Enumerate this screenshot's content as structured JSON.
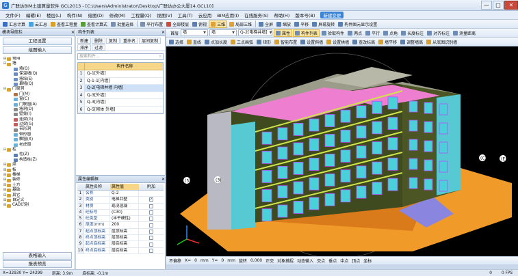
{
  "window": {
    "title": "广联达BIM土建算量软件 GCL2013 - [C:\\Users\\Administrator\\Desktop\\广联达办公大厦14.GCL10]",
    "app_icon": "G",
    "controls": [
      "—",
      "□",
      "✕"
    ]
  },
  "menu": [
    "文件(F)",
    "编辑(E)",
    "楼层(L)",
    "构件(N)",
    "绘图(D)",
    "修改(M)",
    "工程量(Q)",
    "视图(V)",
    "工具(T)",
    "云应用",
    "BIM应用(I)",
    "在线服务(S)",
    "帮助(H)",
    "版本号(B)",
    "新建变更"
  ],
  "toolbar1": [
    {
      "label": "汇总计算",
      "icon": "sigma-icon",
      "color": "#3a6fc4"
    },
    {
      "label": "云汇总",
      "icon": "cloud-icon",
      "color": "#4aa3e0"
    },
    {
      "label": "查看工程量",
      "icon": "table-icon",
      "color": "#d9a12a"
    },
    {
      "label": "查看计算式",
      "icon": "formula-icon",
      "color": "#5b9c3a"
    },
    {
      "label": "批量选择",
      "icon": "select-icon",
      "color": "#7b8fae"
    },
    {
      "label": "平行布置",
      "icon": "parallel-icon",
      "color": "#7b8fae"
    },
    {
      "label": "全部楼层",
      "icon": "layers-icon",
      "color": "#c94f3a"
    },
    {
      "label": "俯视",
      "icon": "view-icon",
      "color": "#5a7fb0"
    },
    {
      "label": "三维",
      "icon": "cube-icon",
      "color": "#e0a03a"
    },
    {
      "label": "局部三维",
      "icon": "cube-icon",
      "color": "#e0a03a"
    },
    {
      "label": "全屏",
      "icon": "fullscreen-icon",
      "color": "#5a7fb0"
    },
    {
      "label": "缩放",
      "icon": "zoom-icon",
      "color": "#5a7fb0"
    },
    {
      "label": "平移",
      "icon": "pan-icon",
      "color": "#5a7fb0"
    },
    {
      "label": "屏幕旋转",
      "icon": "rotate-icon",
      "color": "#5a7fb0"
    },
    {
      "label": "构件图元显示设置",
      "icon": "settings-icon",
      "color": "#5a7fb0"
    }
  ],
  "toolbar2": {
    "floor_label": "首层",
    "type_combo": "墙",
    "sub_combo": "墙",
    "element_combo": "Q-2[电梯井墙]",
    "buttons": [
      "属性",
      "构件列表",
      "拾取构件",
      "两点",
      "平行",
      "点角",
      "长度标注",
      "对齐标注",
      "测量距离"
    ]
  },
  "toolbar3": [
    "选择",
    "直线",
    "点加长度",
    "三点画弧",
    "矩形",
    "智能布置",
    "设置斜墙",
    "设置拱墙",
    "查改标高",
    "墙平移",
    "调整墙高",
    "从底图识别墙"
  ],
  "nav": {
    "title": "模块导航栏",
    "buttons": [
      "工程设置",
      "绘图输入"
    ],
    "tree": [
      {
        "label": "常用",
        "level": 0,
        "expanded": false,
        "color": "#d9a12a"
      },
      {
        "label": "墙",
        "level": 0,
        "expanded": true,
        "color": "#d9a12a"
      },
      {
        "label": "墙(Q)",
        "level": 1,
        "color": "#6a8fc6"
      },
      {
        "label": "保温墙(Q)",
        "level": 1,
        "color": "#6a8fc6"
      },
      {
        "label": "墙垛(E)",
        "level": 1,
        "color": "#6a8fc6"
      },
      {
        "label": "幕墙(Q)",
        "level": 1,
        "color": "#6a8fc6"
      },
      {
        "label": "门窗洞",
        "level": 0,
        "expanded": true,
        "color": "#d9a12a"
      },
      {
        "label": "门(M)",
        "level": 1,
        "color": "#b0764a"
      },
      {
        "label": "窗(C)",
        "level": 1,
        "color": "#6ab0d8"
      },
      {
        "label": "门联窗(A)",
        "level": 1,
        "color": "#6ab0d8"
      },
      {
        "label": "墙洞(D)",
        "level": 1,
        "color": "#888"
      },
      {
        "label": "壁龛(I)",
        "level": 1,
        "color": "#888"
      },
      {
        "label": "连梁(G)",
        "level": 1,
        "color": "#c45a5a"
      },
      {
        "label": "过梁(G)",
        "level": 1,
        "color": "#c45a5a"
      },
      {
        "label": "带形洞",
        "level": 1,
        "color": "#888"
      },
      {
        "label": "带形窗",
        "level": 1,
        "color": "#6ab0d8"
      },
      {
        "label": "飘窗(X)",
        "level": 1,
        "color": "#6ab0d8"
      },
      {
        "label": "老虎窗",
        "level": 1,
        "color": "#6ab0d8"
      },
      {
        "label": "柱",
        "level": 0,
        "expanded": true,
        "color": "#d9a12a"
      },
      {
        "label": "柱(Z)",
        "level": 1,
        "color": "#5a7fb0"
      },
      {
        "label": "构造柱(Z)",
        "level": 1,
        "color": "#5a7fb0"
      },
      {
        "label": "梁",
        "level": 0,
        "expanded": false,
        "color": "#d9a12a"
      },
      {
        "label": "板",
        "level": 0,
        "expanded": false,
        "color": "#d9a12a"
      },
      {
        "label": "楼梯",
        "level": 0,
        "expanded": false,
        "color": "#d9a12a"
      },
      {
        "label": "装修",
        "level": 0,
        "expanded": false,
        "color": "#d9a12a"
      },
      {
        "label": "土方",
        "level": 0,
        "expanded": false,
        "color": "#d9a12a"
      },
      {
        "label": "基础",
        "level": 0,
        "expanded": false,
        "color": "#d9a12a"
      },
      {
        "label": "其它",
        "level": 0,
        "expanded": false,
        "color": "#d9a12a"
      },
      {
        "label": "自定义",
        "level": 0,
        "expanded": false,
        "color": "#d9a12a"
      },
      {
        "label": "CAD识别",
        "level": 0,
        "expanded": false,
        "color": "#d9a12a"
      }
    ],
    "footer_buttons": [
      "表格输入",
      "报表预览"
    ]
  },
  "component_list": {
    "title": "构件列表",
    "toolbar": [
      "新建",
      "删除",
      "复制",
      "重命名",
      "层间复制",
      "排序",
      "过滤"
    ],
    "search_placeholder": "搜索构件...",
    "header": "构件名称",
    "rows": [
      {
        "n": "1",
        "name": "Q-1[外墙]"
      },
      {
        "n": "2",
        "name": "Q-1-1[内墙]"
      },
      {
        "n": "3",
        "name": "Q-2[电梯井墙 内墙]"
      },
      {
        "n": "4",
        "name": "Q-3[外墙]"
      },
      {
        "n": "5",
        "name": "Q-3[内墙]"
      },
      {
        "n": "6",
        "name": "Q-5[砌体 外墙]"
      }
    ],
    "selected_index": 2
  },
  "property_editor": {
    "title": "属性编辑框",
    "headers": {
      "name": "属性名称",
      "value": "属性值",
      "extra": "附加"
    },
    "rows": [
      {
        "n": "1",
        "k": "名称",
        "v": "Q-2",
        "checked": null
      },
      {
        "n": "2",
        "k": "类别",
        "v": "电梯井壁",
        "checked": true
      },
      {
        "n": "3",
        "k": "材质",
        "v": "现浇混凝",
        "checked": false
      },
      {
        "n": "4",
        "k": "砼标号",
        "v": "(C30)",
        "checked": false
      },
      {
        "n": "5",
        "k": "砼类型",
        "v": "(半干硬性)",
        "checked": false
      },
      {
        "n": "6",
        "k": "厚度(mm)",
        "v": "200",
        "checked": false
      },
      {
        "n": "7",
        "k": "起点顶标高",
        "v": "层顶标高",
        "checked": false
      },
      {
        "n": "8",
        "k": "终点顶标高",
        "v": "层顶标高",
        "checked": false
      },
      {
        "n": "9",
        "k": "起点底标高",
        "v": "层底标高",
        "checked": false
      },
      {
        "n": "10",
        "k": "终点底标高",
        "v": "层底标高",
        "checked": false
      }
    ]
  },
  "viewport": {
    "axis_labels": [
      "(A)",
      "(C)",
      "(E)",
      "(5)",
      "(3)"
    ],
    "background": "#000000"
  },
  "bottom_toolbar": [
    "不偏移",
    "X=",
    "0",
    "mm",
    "Y=",
    "0",
    "mm",
    "旋转",
    "0.000",
    "正交",
    "对象捕捉",
    "动态输入",
    "交点",
    "垂点",
    "中点",
    "顶点",
    "坐标"
  ],
  "status": {
    "coords": "X=32930  Y=-24299",
    "floor_height": "层高: 3.9m",
    "elevation": "底标高: -0.1m",
    "count": "0",
    "fps": "0 FPS"
  }
}
